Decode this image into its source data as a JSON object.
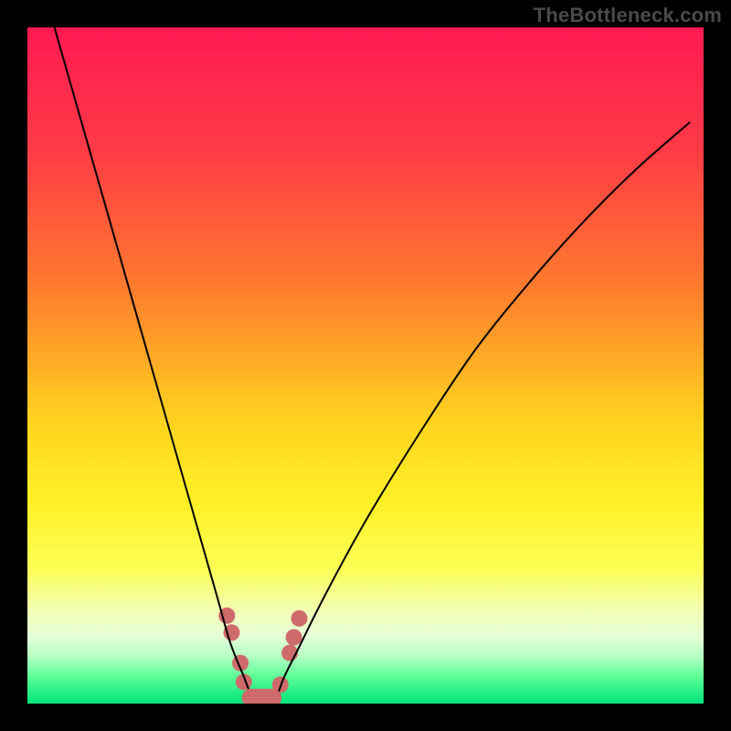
{
  "watermark": {
    "text": "TheBottleneck.com"
  },
  "colors": {
    "black": "#000000",
    "curve": "#000000",
    "marker": "#cf6a6a",
    "gradient_stops": [
      {
        "pct": 0,
        "color": "#ff1a52"
      },
      {
        "pct": 18,
        "color": "#ff3a46"
      },
      {
        "pct": 38,
        "color": "#ff7a2e"
      },
      {
        "pct": 58,
        "color": "#ffd21f"
      },
      {
        "pct": 70,
        "color": "#fff026"
      },
      {
        "pct": 80,
        "color": "#fdff55"
      },
      {
        "pct": 86,
        "color": "#f2ffb0"
      },
      {
        "pct": 90,
        "color": "#e6ffd8"
      },
      {
        "pct": 93,
        "color": "#b6ffc4"
      },
      {
        "pct": 96,
        "color": "#5bff95"
      },
      {
        "pct": 100,
        "color": "#00e27a"
      }
    ]
  },
  "chart_data": {
    "type": "line",
    "title": "",
    "xlabel": "",
    "ylabel": "",
    "xlim": [
      0,
      100
    ],
    "ylim": [
      0,
      100
    ],
    "note": "V-shaped bottleneck curve. x is an arbitrary hardware-balance axis (0–100). y is mismatch severity (0 = balanced/green, 100 = severe/red). Values estimated from pixel positions; no numeric axes are shown in the source image.",
    "series": [
      {
        "name": "bottleneck-curve",
        "x": [
          4,
          8,
          12,
          16,
          20,
          24,
          28,
          30,
          32,
          33,
          34,
          35,
          36,
          37,
          38,
          40,
          44,
          50,
          58,
          66,
          74,
          82,
          90,
          98
        ],
        "y": [
          100,
          86,
          72,
          58,
          44,
          30,
          16,
          9,
          4,
          1.5,
          0.7,
          0.5,
          0.7,
          1.5,
          4,
          8,
          16,
          27,
          40,
          52,
          62,
          71,
          79,
          86
        ]
      }
    ],
    "markers": {
      "name": "highlighted-points",
      "note": "Salmon dots/blobs clustered around the curve's minimum and flat bottom segment.",
      "points": [
        {
          "x": 29.5,
          "y": 13.0
        },
        {
          "x": 30.2,
          "y": 10.5
        },
        {
          "x": 31.5,
          "y": 6.0
        },
        {
          "x": 32.0,
          "y": 3.2
        },
        {
          "x": 32.8,
          "y": 1.3
        },
        {
          "x": 33.6,
          "y": 0.6
        },
        {
          "x": 34.6,
          "y": 0.5
        },
        {
          "x": 35.6,
          "y": 0.6
        },
        {
          "x": 36.5,
          "y": 1.2
        },
        {
          "x": 37.4,
          "y": 2.8
        },
        {
          "x": 38.8,
          "y": 7.5
        },
        {
          "x": 39.4,
          "y": 9.8
        },
        {
          "x": 40.2,
          "y": 12.6
        }
      ]
    }
  }
}
